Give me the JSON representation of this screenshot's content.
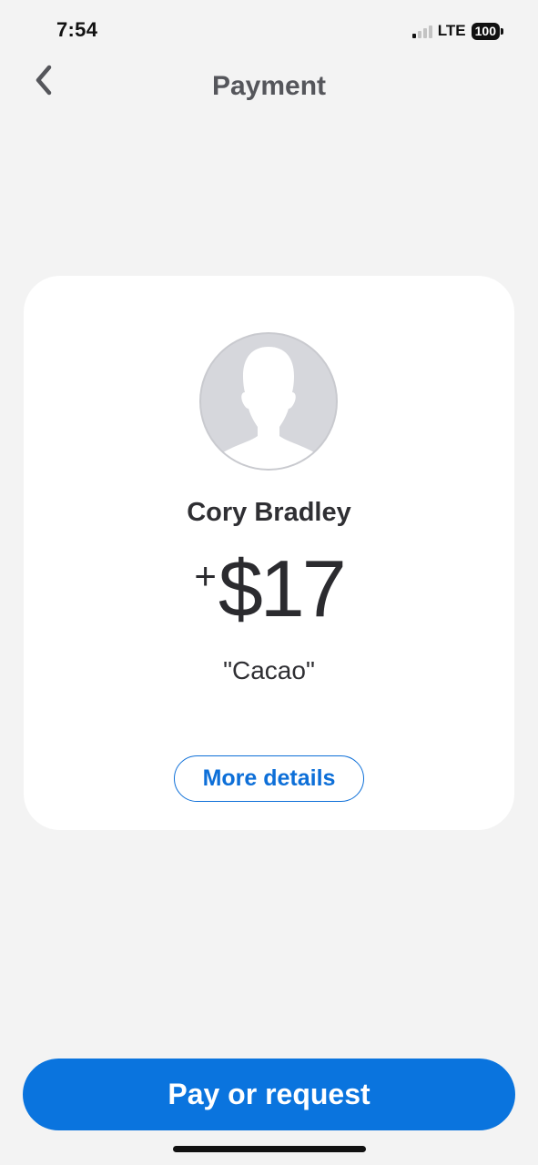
{
  "status_bar": {
    "time": "7:54",
    "network": "LTE",
    "battery": "100"
  },
  "header": {
    "title": "Payment",
    "back_icon": "chevron-left-icon"
  },
  "payment": {
    "avatar_icon": "default-person-avatar-icon",
    "name": "Cory Bradley",
    "amount_sign": "+",
    "amount": "$17",
    "note": "\"Cacao\"",
    "details_button": "More details"
  },
  "footer": {
    "pay_button": "Pay or request"
  },
  "colors": {
    "accent": "#0a74de",
    "background": "#f3f3f3",
    "card": "#ffffff",
    "title": "#55565b"
  }
}
